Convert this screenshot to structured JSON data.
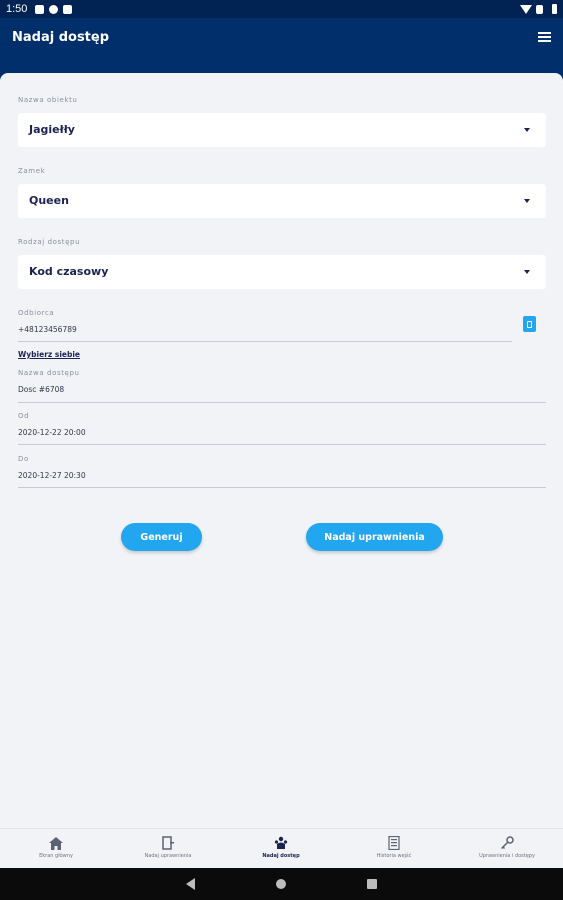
{
  "status": {
    "time": "1:50"
  },
  "appbar": {
    "title": "Nadaj dostęp"
  },
  "form": {
    "object": {
      "label": "Nazwa obiektu",
      "value": "Jagiełły"
    },
    "lock": {
      "label": "Zamek",
      "value": "Queen"
    },
    "access_type": {
      "label": "Rodzaj dostępu",
      "value": "Kod czasowy"
    },
    "recipient": {
      "label": "Odbiorca",
      "value": "+48123456789"
    },
    "choose_self": "Wybierz siebie",
    "access_name": {
      "label": "Nazwa dostępu",
      "value": "Dosc #6708"
    },
    "from": {
      "label": "Od",
      "value": "2020-12-22 20:00"
    },
    "to": {
      "label": "Do",
      "value": "2020-12-27 20:30"
    }
  },
  "buttons": {
    "generate": "Generuj",
    "grant": "Nadaj uprawnienia"
  },
  "bottom_nav": [
    {
      "label": "Ekran główny",
      "icon": "home-icon",
      "active": false
    },
    {
      "label": "Nadaj uprawnienia",
      "icon": "door-icon",
      "active": false
    },
    {
      "label": "Nadaj dostęp",
      "icon": "people-icon",
      "active": true
    },
    {
      "label": "Historia wejść",
      "icon": "history-icon",
      "active": false
    },
    {
      "label": "Uprawnienia i dostępy",
      "icon": "key-icon",
      "active": false
    }
  ],
  "colors": {
    "header": "#002f6c",
    "accent": "#22a6f0",
    "background": "#f1f3f7"
  }
}
